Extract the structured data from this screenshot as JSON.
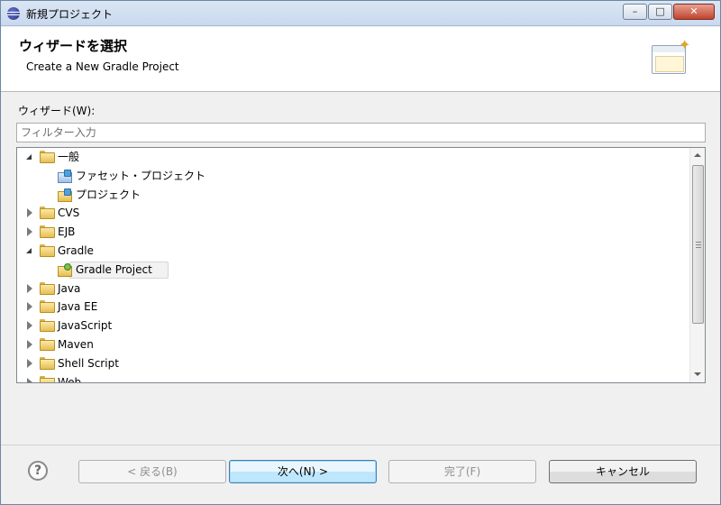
{
  "window": {
    "title": "新規プロジェクト",
    "minimize_label": "–",
    "maximize_label": "□",
    "close_label": "✕"
  },
  "header": {
    "title": "ウィザードを選択",
    "description": "Create a New Gradle Project"
  },
  "wizards": {
    "label": "ウィザード(W):",
    "filter_placeholder": "フィルター入力",
    "items": [
      {
        "label": "一般",
        "state": "expanded",
        "level": 0,
        "icon": "folder-icon"
      },
      {
        "label": "ファセット・プロジェクト",
        "state": "leaf",
        "level": 1,
        "icon": "facet-project-icon"
      },
      {
        "label": "プロジェクト",
        "state": "leaf",
        "level": 1,
        "icon": "project-icon"
      },
      {
        "label": "CVS",
        "state": "collapsed",
        "level": 0,
        "icon": "folder-icon"
      },
      {
        "label": "EJB",
        "state": "collapsed",
        "level": 0,
        "icon": "folder-icon"
      },
      {
        "label": "Gradle",
        "state": "expanded",
        "level": 0,
        "icon": "folder-icon"
      },
      {
        "label": "Gradle Project",
        "state": "leaf",
        "level": 1,
        "icon": "gradle-project-icon",
        "selected": true
      },
      {
        "label": "Java",
        "state": "collapsed",
        "level": 0,
        "icon": "folder-icon"
      },
      {
        "label": "Java EE",
        "state": "collapsed",
        "level": 0,
        "icon": "folder-icon"
      },
      {
        "label": "JavaScript",
        "state": "collapsed",
        "level": 0,
        "icon": "folder-icon"
      },
      {
        "label": "Maven",
        "state": "collapsed",
        "level": 0,
        "icon": "folder-icon"
      },
      {
        "label": "Shell Script",
        "state": "collapsed",
        "level": 0,
        "icon": "folder-icon"
      },
      {
        "label": "Web",
        "state": "collapsed",
        "level": 0,
        "icon": "folder-icon"
      }
    ]
  },
  "footer": {
    "help_label": "?",
    "back_label": "< 戻る(B)",
    "next_label": "次へ(N) >",
    "finish_label": "完了(F)",
    "cancel_label": "キャンセル"
  }
}
